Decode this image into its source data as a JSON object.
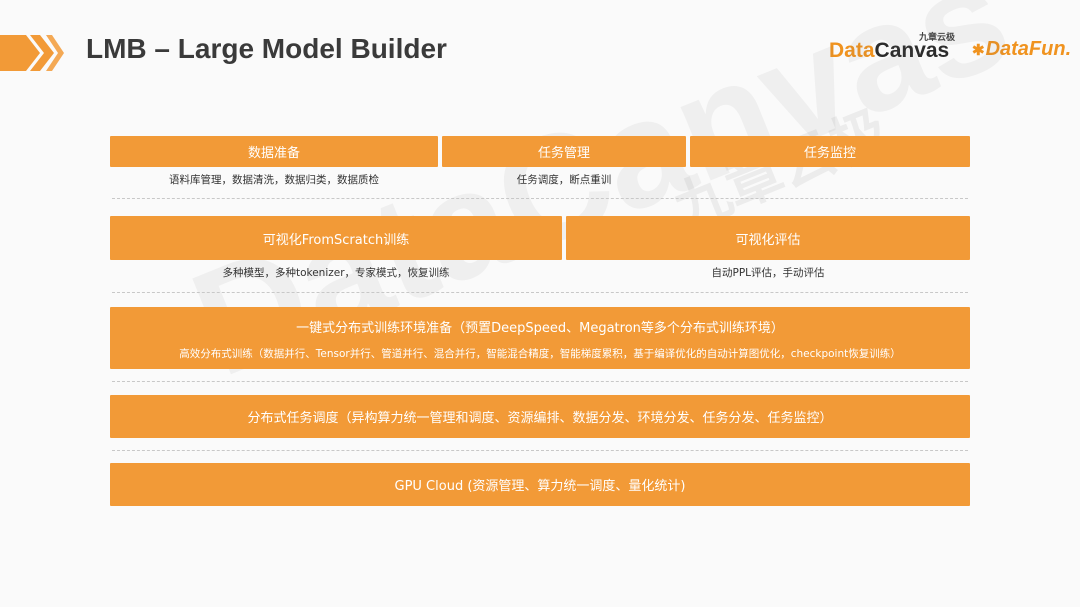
{
  "header": {
    "title": "LMB – Large Model Builder",
    "logo_cn": "九章云极",
    "logo_datacanvas_part1": "Data",
    "logo_datacanvas_part2": "Canvas",
    "logo_datafun": "DataFun."
  },
  "colors": {
    "accent": "#f29a37",
    "title_text": "#3a3a3a",
    "background": "#fafafa"
  },
  "watermark": {
    "text": "DataCanvas",
    "cn_text": "九章云极"
  },
  "rows": {
    "row1": {
      "blocks": [
        {
          "label": "数据准备",
          "caption": "语料库管理，数据清洗，数据归类，数据质检"
        },
        {
          "label": "任务管理",
          "caption": "任务调度，断点重训"
        },
        {
          "label": "任务监控"
        }
      ]
    },
    "row2": {
      "blocks": [
        {
          "label": "可视化FromScratch训练",
          "caption": "多种模型，多种tokenizer，专家模式，恢复训练"
        },
        {
          "label": "可视化评估",
          "caption": "自动PPL评估，手动评估"
        }
      ]
    },
    "row3": {
      "label": "一键式分布式训练环境准备（预置DeepSpeed、Megatron等多个分布式训练环境）",
      "caption": "高效分布式训练（数据并行、Tensor并行、管道并行、混合并行，智能混合精度，智能梯度累积，基于编译优化的自动计算图优化，checkpoint恢复训练）"
    },
    "row4": {
      "label": "分布式任务调度（异构算力统一管理和调度、资源编排、数据分发、环境分发、任务分发、任务监控）"
    },
    "row5": {
      "label": "GPU Cloud (资源管理、算力统一调度、量化统计)"
    }
  }
}
